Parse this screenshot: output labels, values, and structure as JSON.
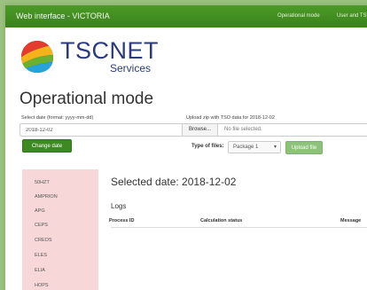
{
  "navbar": {
    "brand": "Web interface - VICTORIA",
    "links": [
      "Operational mode",
      "User and TS"
    ]
  },
  "logo": {
    "name": "TSCNET",
    "tagline": "Services"
  },
  "page_title": "Operational mode",
  "date_form": {
    "label": "Select date (format: yyyy-mm-dd)",
    "value": "2018-12-02",
    "button": "Change date"
  },
  "upload_form": {
    "label": "Upload zip with TSO data for 2018-12-02",
    "browse_button": "Browse...",
    "file_status": "No file selected.",
    "type_label": "Type of files:",
    "type_selected": "Package 1",
    "upload_button": "Upload file"
  },
  "sidebar": {
    "items": [
      "50HZT",
      "AMPRION",
      "APG",
      "CEPS",
      "CREOS",
      "ELES",
      "ELIA",
      "HOPS"
    ]
  },
  "selected_date_text": "Selected date: 2018-12-02",
  "logs": {
    "title": "Logs",
    "columns": [
      "Process ID",
      "Calculation status",
      "Message"
    ]
  },
  "colors": {
    "navbar": "#3f8a1f",
    "brand_blue": "#2a3a7c",
    "sidebar_bg": "#f7d7d7",
    "button_green": "#3d8a22",
    "button_light_green": "#8cc27a"
  }
}
